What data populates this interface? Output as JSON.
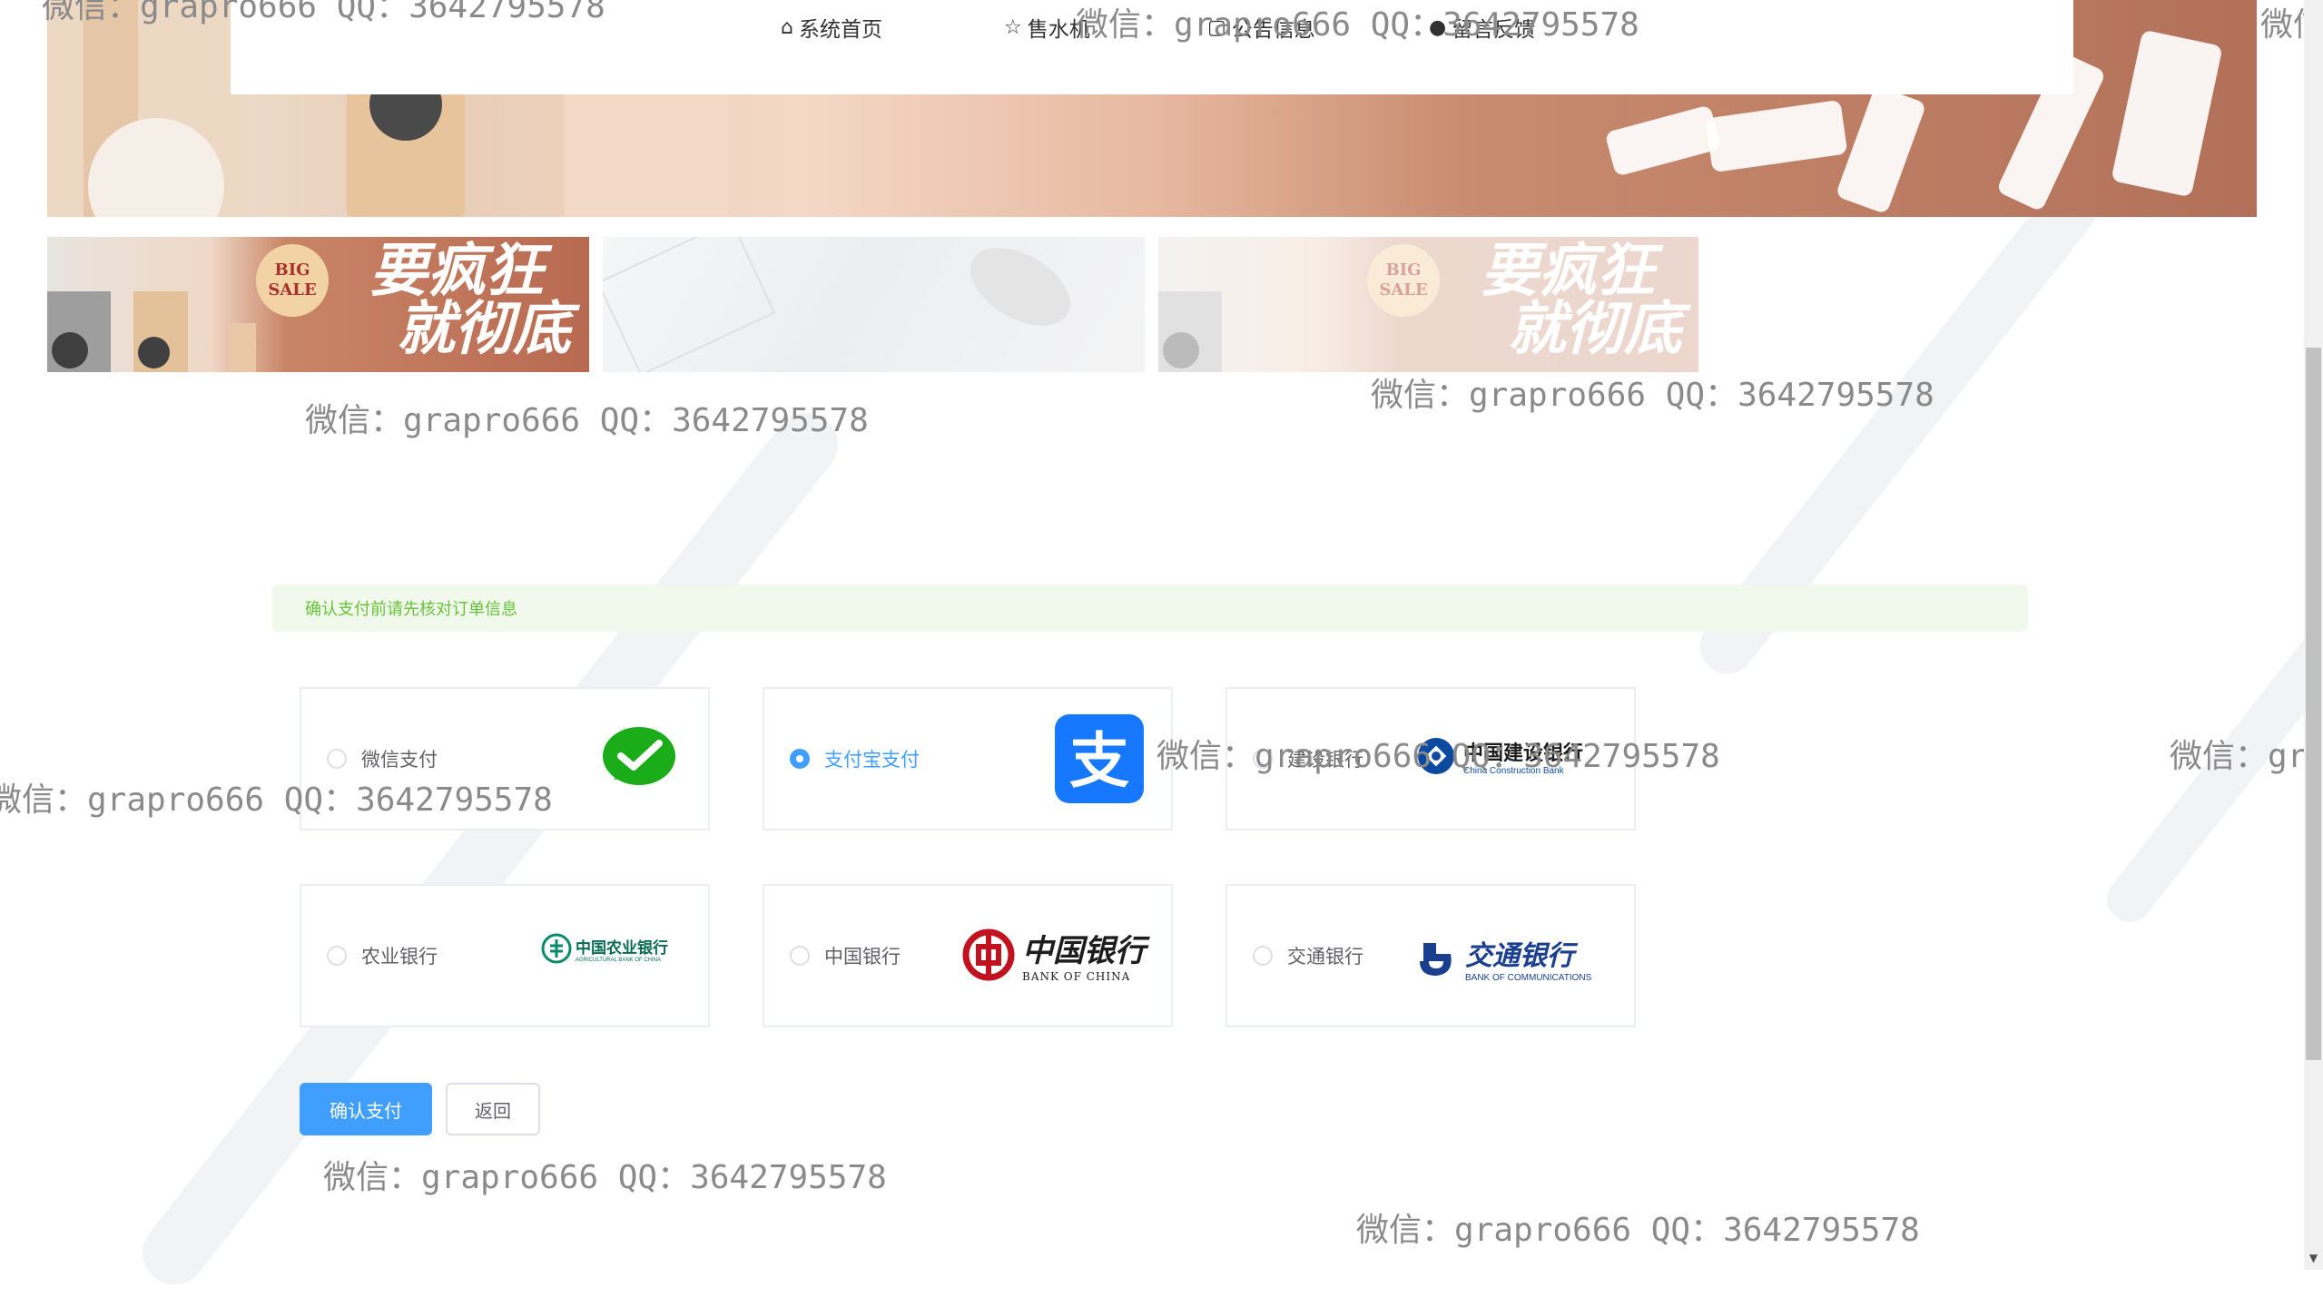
{
  "nav": {
    "items": [
      {
        "label": "系统首页",
        "icon": "home-icon"
      },
      {
        "label": "售水机",
        "icon": "star-icon"
      },
      {
        "label": "公告信息",
        "icon": "notice-icon"
      },
      {
        "label": "留言反馈",
        "icon": "feedback-icon"
      }
    ]
  },
  "banner": {
    "big_sale": [
      "BIG",
      "SALE"
    ],
    "slogan": [
      "要疯狂",
      "就彻底"
    ]
  },
  "watermark": "微信：grapro666 QQ：3642795578",
  "alert": {
    "text": "确认支付前请先核对订单信息"
  },
  "payment": {
    "selected": "支付宝支付",
    "options": [
      {
        "label": "微信支付",
        "logo": "wechat-pay-logo"
      },
      {
        "label": "支付宝支付",
        "logo": "alipay-logo"
      },
      {
        "label": "建设银行",
        "logo": "ccb-logo",
        "logo_zh": "中国建设银行",
        "logo_en": "China Construction Bank"
      },
      {
        "label": "农业银行",
        "logo": "abc-logo",
        "logo_zh": "中国农业银行",
        "logo_en": "AGRICULTURAL BANK OF CHINA"
      },
      {
        "label": "中国银行",
        "logo": "boc-logo",
        "logo_zh": "中国银行",
        "logo_en": "BANK OF CHINA"
      },
      {
        "label": "交通银行",
        "logo": "bocom-logo",
        "logo_zh": "交通银行",
        "logo_en": "BANK OF COMMUNICATIONS"
      }
    ]
  },
  "buttons": {
    "confirm": "确认支付",
    "back": "返回"
  },
  "colors": {
    "primary": "#409eff",
    "success_text": "#67c23a",
    "success_bg": "#f0f9eb",
    "wechat": "#1aad19",
    "alipay": "#1677ff"
  }
}
